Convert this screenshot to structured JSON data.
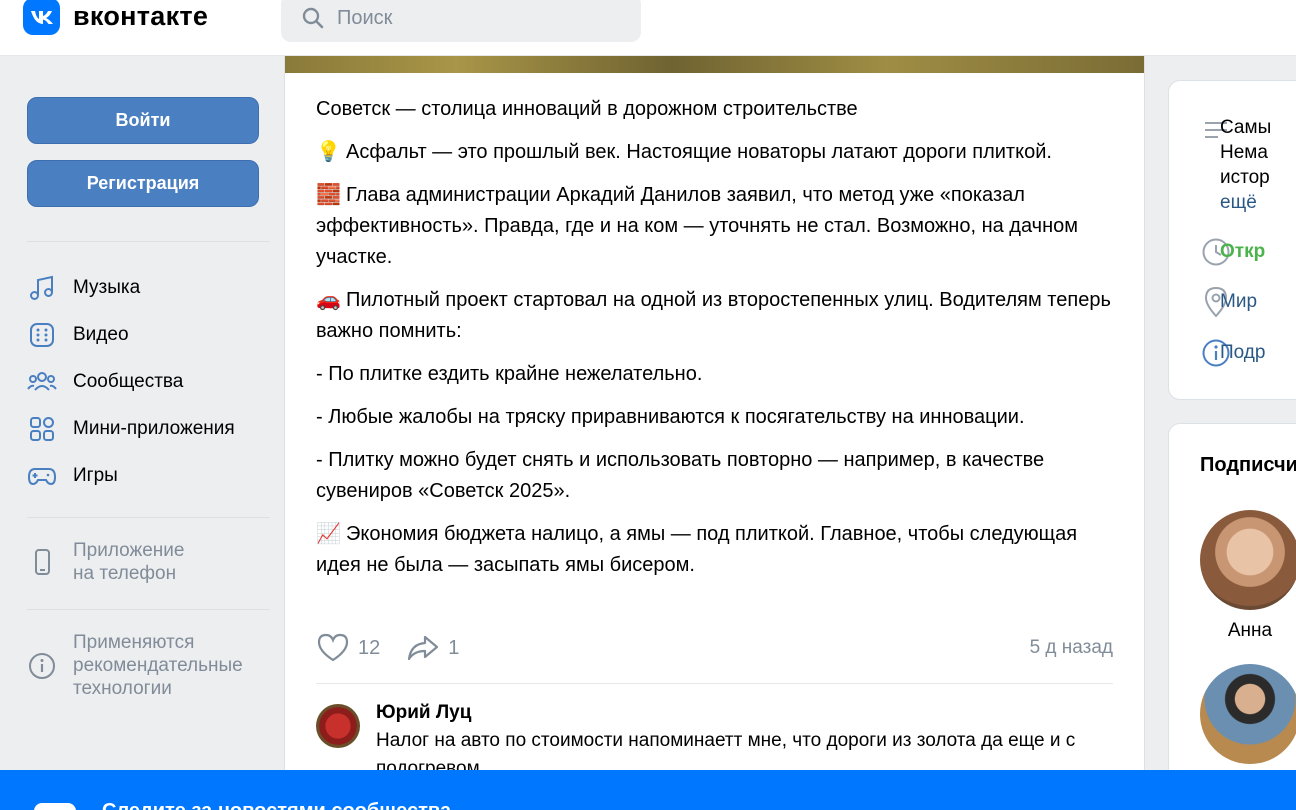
{
  "header": {
    "logo_text": "вконтакте",
    "search_placeholder": "Поиск"
  },
  "sidebar": {
    "login_label": "Войти",
    "register_label": "Регистрация",
    "items": [
      {
        "label": "Музыка",
        "icon": "music-icon"
      },
      {
        "label": "Видео",
        "icon": "video-icon"
      },
      {
        "label": "Сообщества",
        "icon": "communities-icon"
      },
      {
        "label": "Мини-приложения",
        "icon": "mini-apps-icon"
      },
      {
        "label": "Игры",
        "icon": "gamepad-icon"
      }
    ],
    "phone_app": "Приложение\nна телефон",
    "recommendations": "Применяются\nрекомендательные\nтехнологии"
  },
  "post": {
    "title": "Советск — столица инноваций в дорожном строительстве",
    "paragraphs": [
      {
        "emoji": "💡",
        "text": "Асфальт — это прошлый век. Настоящие новаторы латают дороги плиткой."
      },
      {
        "emoji": "🧱",
        "text": "Глава администрации Аркадий Данилов заявил, что метод уже «показал эффективность». Правда, где и на ком — уточнять не стал. Возможно, на дачном участке."
      },
      {
        "emoji": "🚗",
        "text": "Пилотный проект стартовал на одной из второстепенных улиц. Водителям теперь важно помнить:"
      }
    ],
    "bullets": [
      "- По плитке ездить крайне нежелательно.",
      "- Любые жалобы на тряску приравниваются к посягательству на инновации.",
      "- Плитку можно будет снять и использовать повторно — например, в качестве сувениров «Советск 2025»."
    ],
    "closing": {
      "emoji": "📈",
      "text": "Экономия бюджета налицо, а ямы — под плиткой. Главное, чтобы следующая идея не была — засыпать ямы бисером."
    },
    "likes": "12",
    "shares": "1",
    "time": "5 д назад"
  },
  "comment": {
    "author": "Юрий Луц",
    "text": "Налог на авто по стоимости напоминаетт мне, что дороги из золота да еще и с подогревом"
  },
  "info": {
    "description": [
      "Самы",
      "Нема",
      "истор"
    ],
    "more": "ещё",
    "open": "Откр",
    "location": "Мир",
    "details": "Подр"
  },
  "subscribers": {
    "title": "Подписчи",
    "people": [
      {
        "name": "Анна"
      }
    ]
  },
  "banner": {
    "text": "Следите за новостями сообщества"
  },
  "colors": {
    "accent": "#0077ff",
    "button": "#4a7fc1",
    "open_status": "#4bb34b",
    "link": "#2a5885"
  }
}
